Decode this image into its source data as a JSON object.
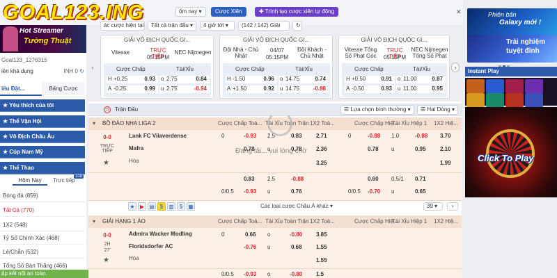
{
  "logo_text": "GOAL123.ING",
  "topbar": {
    "sport_select": "Bóng đá",
    "home_label": "ốm nay",
    "combo_button": "Cược Xiên",
    "create_combo_button": "Trình tạo cược xiên tự động",
    "filter_tag1": "ác cược hiện tại",
    "filter_tag2": "Tất cả trận đấu",
    "time_select": "4 giờ tới",
    "count": "(142 / 142) Giải"
  },
  "sidebar": {
    "streamer_line1": "Hot Streamer",
    "streamer_line2": "Tường Thuật",
    "username": "Goal123_1276315",
    "balance_label": "iền khả dụng",
    "balance_value": "INH 0",
    "tab_bet_slip": "iếu Đặt...",
    "tab_bet_list": "Bảng Cược",
    "sections": [
      "Yêu thích của tôi",
      "Thế Vận Hội",
      "Vô Địch Châu Âu",
      "Cúp Nam Mỹ",
      "Thể Thao"
    ],
    "subtabs": {
      "today": "Hôm Nay",
      "live": "Trực tiếp",
      "live_badge": "108"
    },
    "sport": "Bóng đá (859)",
    "items": [
      {
        "label": "Tất Cả (770)"
      },
      {
        "label": "1X2 (548)"
      },
      {
        "label": "Tỷ Số Chính Xác (468)"
      },
      {
        "label": "Lẻ/Chẵn (532)"
      },
      {
        "label": "Tổng Số Bàn Thắng (466)"
      }
    ],
    "status": "ấp kết nối an toàn."
  },
  "cards": [
    {
      "title": "GIẢI VÔ ĐỊCH QUỐC GI...",
      "home": "Vitesse",
      "status": "TRỰC TIẾP",
      "time": "05:15PM",
      "away": "NEC Nijmegen",
      "hcap_label": "Cược Chấp",
      "ou_label": "Tài/Xỉu",
      "r1": [
        "H",
        "+0.25",
        "0.93",
        "o",
        "2.75",
        "0.84"
      ],
      "r2": [
        "A",
        "-0.25",
        "0.99",
        "u",
        "2.75",
        "-0.94"
      ]
    },
    {
      "title": "GIẢI VÔ ĐỊCH QUỐC GI...",
      "home": "Đội Nhà - Chủ Nhật",
      "status": "04/07",
      "time": "05:15PM",
      "away": "Đội Khách - Chủ Nhật",
      "hcap_label": "Cược Chấp",
      "ou_label": "Tài/Xỉu",
      "r1": [
        "H",
        "-1.50",
        "0.96",
        "o",
        "14.75",
        "0.74"
      ],
      "r2": [
        "A",
        "+1.50",
        "0.92",
        "u",
        "14.75",
        "-0.88"
      ]
    },
    {
      "title": "GIẢI VÔ ĐỊCH QUỐC GI...",
      "home": "Vitesse Tổng Số Phạt Góc",
      "status": "TRỰC TIẾP",
      "time": "05:15PM",
      "away": "NEC Nijmegen Tổng Số Phạt",
      "hcap_label": "Cược Chấp",
      "ou_label": "Tài/Xỉu",
      "r1": [
        "H",
        "+0.50",
        "0.91",
        "o",
        "11.00",
        "0.87"
      ],
      "r2": [
        "A",
        "-0.50",
        "0.93",
        "u",
        "11.00",
        "0.95"
      ]
    }
  ],
  "main": {
    "header_title": "Trận Đấu",
    "sort_select": "Lựa chọn bình thường",
    "view_select": "Hai Dòng",
    "loading_text": "Đang tải... vui lòng chờ",
    "cols": [
      "Cược Chấp Toà...",
      "Tài Xỉu Toàn Trận",
      "1X2 Toà...",
      "Cược Chấp Hiệ...",
      "Tài Xỉu Hiệp 1",
      "1X2 Hiệ..."
    ],
    "league1": "BỒ ĐÀO NHA LIGA 2",
    "match1": {
      "score": "0-0",
      "state": "TRỰC TIẾP",
      "home": "Lank FC Vilaverdense",
      "away": "Mafra",
      "draw": "Hòa",
      "r1": [
        "0",
        "-0.93",
        "2.5",
        "0.83",
        "2.71",
        "0",
        "-0.88",
        "1.0",
        "-0.88",
        "3.70"
      ],
      "r2": [
        "0.78",
        "u",
        "0.78",
        "2.36",
        "0.78",
        "u",
        "0.95",
        "2.10"
      ],
      "r3": [
        "3.25",
        "1.99"
      ],
      "r4": [
        "0.83",
        "2.5",
        "-0.88",
        "0.60",
        "0.5/1",
        "0.71"
      ],
      "r5": [
        "0/0.5",
        "-0.93",
        "u",
        "0.76",
        "0/0.5",
        "-0.70",
        "u",
        "0.65"
      ],
      "more_bets": "Các loại cược Châu Á khác",
      "page": "39"
    },
    "league2": "GIẢI HẠNG 1 ÁO",
    "match2": {
      "score": "0-0",
      "state": "2H",
      "minute": "27'",
      "home": "Admira Wacker Modling",
      "away": "Floridsdorfer AC",
      "draw": "Hòa",
      "r1": [
        "0",
        "0.66",
        "o",
        "-0.80",
        "3.85"
      ],
      "r2": [
        "-0.76",
        "u",
        "0.68",
        "1.55"
      ],
      "r3": [
        "1.55"
      ],
      "r4": [
        "0/0.5",
        "-0.93",
        "o",
        "-0.80",
        "1.5"
      ]
    }
  },
  "right": {
    "banner1_line1": "Phiên bản",
    "banner1_line2": "Galaxy mới !",
    "banner2_line1": "Trải nghiệm",
    "banner2_line2": "tuyệt đỉnh",
    "instant_play": "Instant Play",
    "click_to_play": "Click To Play"
  }
}
